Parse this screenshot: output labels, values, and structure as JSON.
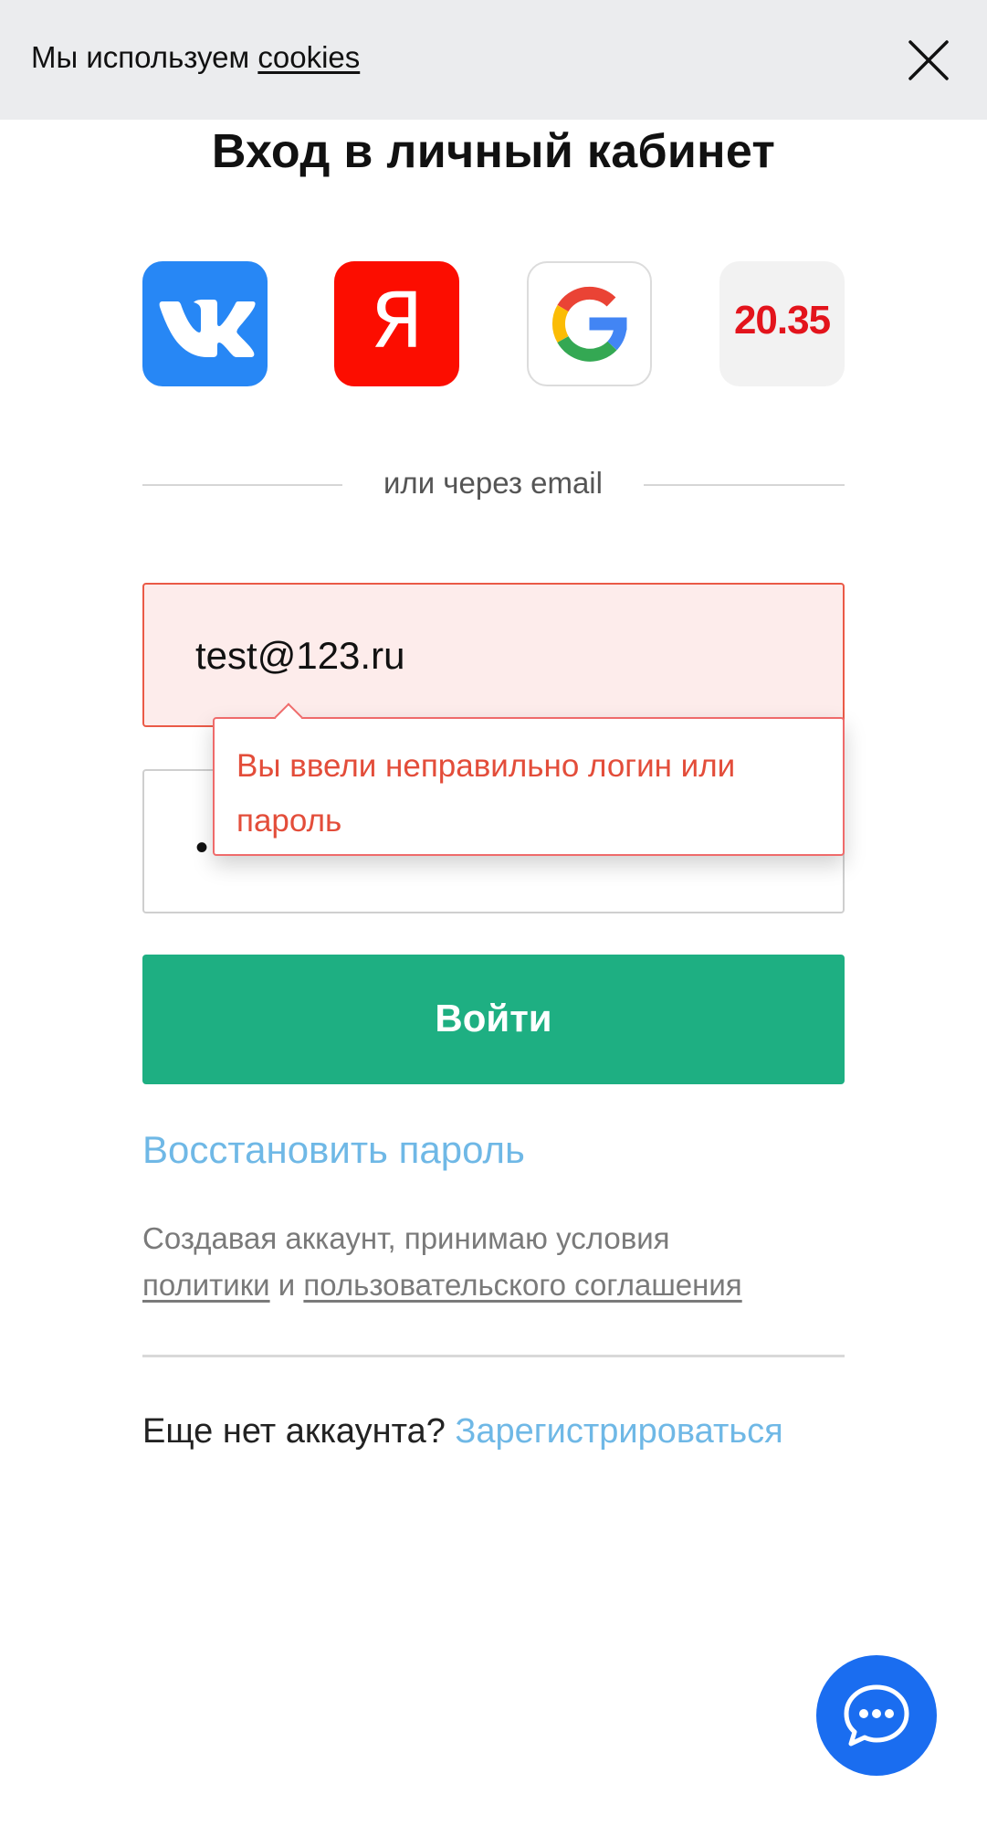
{
  "cookie_bar": {
    "text": "Мы используем ",
    "link": "cookies",
    "close_icon": "close-icon"
  },
  "page": {
    "title": "Вход в личный кабинет"
  },
  "social": {
    "vk_icon": "vk-logo-icon",
    "yandex_letter": "Я",
    "google_icon": "google-logo-icon",
    "n2035_label": "20.35"
  },
  "divider": {
    "label": "или через email"
  },
  "form": {
    "email_value": "test@123.ru",
    "password_mask": "•",
    "error_message": "Вы ввели неправильно логин или пароль",
    "submit_label": "Войти",
    "restore_link": "Восстановить пароль"
  },
  "terms": {
    "prefix": "Создавая аккаунт, принимаю условия",
    "policy_link": "политики",
    "conjunction": " и ",
    "agreement_link": "пользовательского соглашения"
  },
  "register": {
    "question": "Еще нет аккаунта? ",
    "link": "Зарегистрироваться"
  },
  "colors": {
    "accent_green": "#1eaf82",
    "link_blue": "#6fb8e6",
    "error_red": "#e34d3a",
    "chat_blue": "#1a6df0"
  },
  "chat": {
    "icon": "chat-bubble-icon"
  }
}
